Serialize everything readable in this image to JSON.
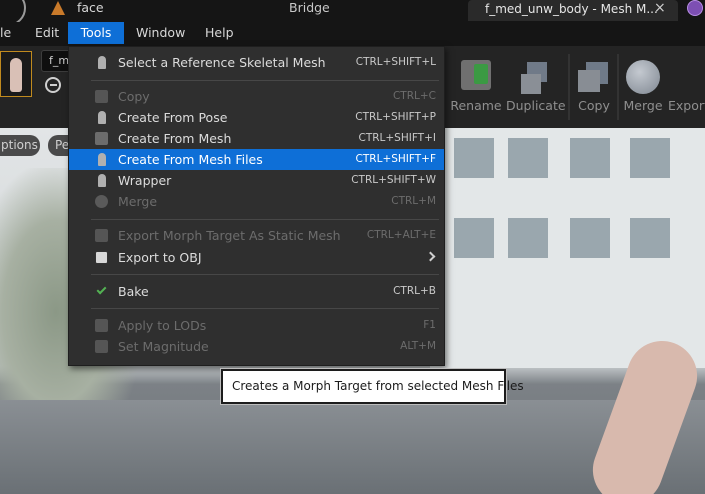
{
  "titlebar": {
    "project": "face",
    "bridge": "Bridge",
    "tab": "f_med_unw_body - Mesh M...",
    "close": "×"
  },
  "menubar": {
    "file": "le",
    "edit": "Edit",
    "tools": "Tools",
    "window": "Window",
    "help": "Help"
  },
  "toolbar": {
    "asset_combo": "f_m",
    "buttons": {
      "rename": "Rename",
      "duplicate": "Duplicate",
      "copy": "Copy",
      "merge": "Merge",
      "export": "Export"
    }
  },
  "viewport": {
    "options": "ptions",
    "perspective": "Pe"
  },
  "tools_menu": {
    "items": [
      {
        "label": "Select a Reference Skeletal Mesh",
        "shortcut": "CTRL+SHIFT+L",
        "enabled": true
      },
      {
        "label": "Copy",
        "shortcut": "CTRL+C",
        "enabled": false
      },
      {
        "label": "Create From Pose",
        "shortcut": "CTRL+SHIFT+P",
        "enabled": true
      },
      {
        "label": "Create From Mesh",
        "shortcut": "CTRL+SHIFT+I",
        "enabled": true
      },
      {
        "label": "Create From Mesh Files",
        "shortcut": "CTRL+SHIFT+F",
        "enabled": true,
        "highlighted": true
      },
      {
        "label": "Wrapper",
        "shortcut": "CTRL+SHIFT+W",
        "enabled": true
      },
      {
        "label": "Merge",
        "shortcut": "CTRL+M",
        "enabled": false
      },
      {
        "label": "Export Morph Target As Static Mesh",
        "shortcut": "CTRL+ALT+E",
        "enabled": false
      },
      {
        "label": "Export to OBJ",
        "shortcut": "",
        "enabled": true,
        "submenu": true
      },
      {
        "label": "Bake",
        "shortcut": "CTRL+B",
        "enabled": true
      },
      {
        "label": "Apply to LODs",
        "shortcut": "F1",
        "enabled": false
      },
      {
        "label": "Set Magnitude",
        "shortcut": "ALT+M",
        "enabled": false
      }
    ]
  },
  "tooltip": {
    "text": "Creates a Morph Target from selected Mesh Files"
  },
  "colors": {
    "accent": "#0e6fd7",
    "menu_bg": "#2f2f2f",
    "disabled_text": "#6c6c6c"
  }
}
